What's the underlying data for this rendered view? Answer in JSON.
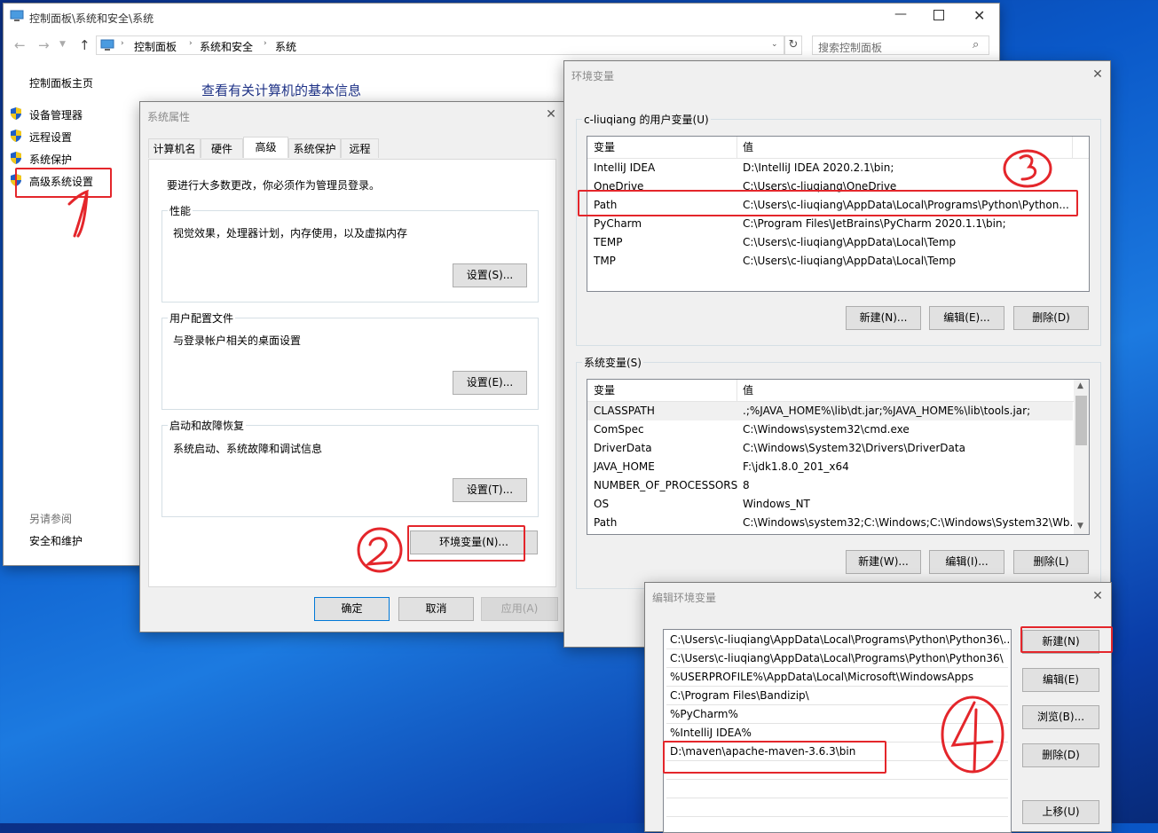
{
  "desktop": {
    "accent": "#0a58c8"
  },
  "cp": {
    "title": "控制面板\\系统和安全\\系统",
    "breadcrumb": [
      "控制面板",
      "系统和安全",
      "系统"
    ],
    "search_placeholder": "搜索控制面板",
    "home": "控制面板主页",
    "nav": [
      "设备管理器",
      "远程设置",
      "系统保护",
      "高级系统设置"
    ],
    "see_also_label": "另请参阅",
    "see_also": "安全和维护",
    "heading": "查看有关计算机的基本信息"
  },
  "sysprops": {
    "title": "系统属性",
    "tabs": [
      "计算机名",
      "硬件",
      "高级",
      "系统保护",
      "远程"
    ],
    "notice": "要进行大多数更改，你必须作为管理员登录。",
    "groups": [
      {
        "label": "性能",
        "desc": "视觉效果，处理器计划，内存使用，以及虚拟内存",
        "button": "设置(S)..."
      },
      {
        "label": "用户配置文件",
        "desc": "与登录帐户相关的桌面设置",
        "button": "设置(E)..."
      },
      {
        "label": "启动和故障恢复",
        "desc": "系统启动、系统故障和调试信息",
        "button": "设置(T)..."
      }
    ],
    "env_button": "环境变量(N)...",
    "ok": "确定",
    "cancel": "取消",
    "apply": "应用(A)"
  },
  "envvars": {
    "title": "环境变量",
    "user_label": "c-liuqiang 的用户变量(U)",
    "col_var": "变量",
    "col_val": "值",
    "user_vars": [
      {
        "name": "IntelliJ IDEA",
        "value": "D:\\IntelliJ IDEA 2020.2.1\\bin;"
      },
      {
        "name": "OneDrive",
        "value": "C:\\Users\\c-liuqiang\\OneDrive"
      },
      {
        "name": "Path",
        "value": "C:\\Users\\c-liuqiang\\AppData\\Local\\Programs\\Python\\Python..."
      },
      {
        "name": "PyCharm",
        "value": "C:\\Program Files\\JetBrains\\PyCharm 2020.1.1\\bin;"
      },
      {
        "name": "TEMP",
        "value": "C:\\Users\\c-liuqiang\\AppData\\Local\\Temp"
      },
      {
        "name": "TMP",
        "value": "C:\\Users\\c-liuqiang\\AppData\\Local\\Temp"
      }
    ],
    "user_buttons": [
      "新建(N)...",
      "编辑(E)...",
      "删除(D)"
    ],
    "sys_label": "系统变量(S)",
    "sys_vars": [
      {
        "name": "CLASSPATH",
        "value": ".;%JAVA_HOME%\\lib\\dt.jar;%JAVA_HOME%\\lib\\tools.jar;"
      },
      {
        "name": "ComSpec",
        "value": "C:\\Windows\\system32\\cmd.exe"
      },
      {
        "name": "DriverData",
        "value": "C:\\Windows\\System32\\Drivers\\DriverData"
      },
      {
        "name": "JAVA_HOME",
        "value": "F:\\jdk1.8.0_201_x64"
      },
      {
        "name": "NUMBER_OF_PROCESSORS",
        "value": "8"
      },
      {
        "name": "OS",
        "value": "Windows_NT"
      },
      {
        "name": "Path",
        "value": "C:\\Windows\\system32;C:\\Windows;C:\\Windows\\System32\\Wb..."
      }
    ],
    "sys_buttons": [
      "新建(W)...",
      "编辑(I)...",
      "删除(L)"
    ]
  },
  "editenv": {
    "title": "编辑环境变量",
    "entries": [
      "C:\\Users\\c-liuqiang\\AppData\\Local\\Programs\\Python\\Python36\\...",
      "C:\\Users\\c-liuqiang\\AppData\\Local\\Programs\\Python\\Python36\\",
      "%USERPROFILE%\\AppData\\Local\\Microsoft\\WindowsApps",
      "C:\\Program Files\\Bandizip\\",
      "%PyCharm%",
      "%IntelliJ IDEA%",
      "D:\\maven\\apache-maven-3.6.3\\bin"
    ],
    "buttons": [
      "新建(N)",
      "编辑(E)",
      "浏览(B)...",
      "删除(D)",
      "上移(U)"
    ]
  }
}
